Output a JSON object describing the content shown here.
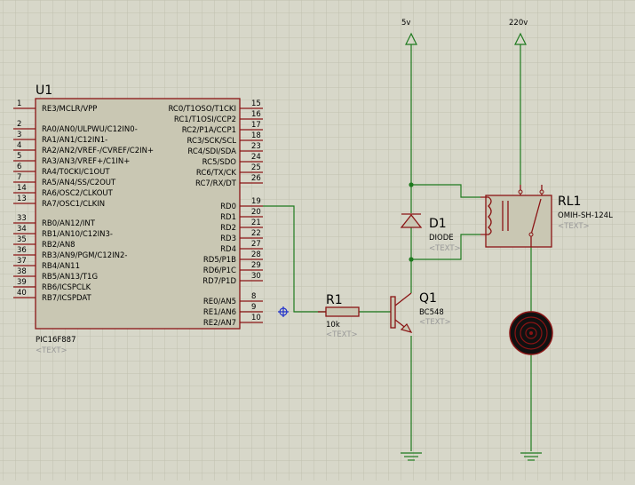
{
  "schematic": {
    "mcu": {
      "ref": "U1",
      "part": "PIC16F887",
      "text_placeholder": "<TEXT>",
      "left_pins": [
        {
          "num": "1",
          "name": "RE3/MCLR/VPP"
        },
        {
          "num": "2",
          "name": "RA0/AN0/ULPWU/C12IN0-"
        },
        {
          "num": "3",
          "name": "RA1/AN1/C12IN1-"
        },
        {
          "num": "4",
          "name": "RA2/AN2/VREF-/CVREF/C2IN+"
        },
        {
          "num": "5",
          "name": "RA3/AN3/VREF+/C1IN+"
        },
        {
          "num": "6",
          "name": "RA4/T0CKI/C1OUT"
        },
        {
          "num": "7",
          "name": "RA5/AN4/SS/C2OUT"
        },
        {
          "num": "14",
          "name": "RA6/OSC2/CLKOUT"
        },
        {
          "num": "13",
          "name": "RA7/OSC1/CLKIN"
        },
        {
          "num": "33",
          "name": "RB0/AN12/INT"
        },
        {
          "num": "34",
          "name": "RB1/AN10/C12IN3-"
        },
        {
          "num": "35",
          "name": "RB2/AN8"
        },
        {
          "num": "36",
          "name": "RB3/AN9/PGM/C12IN2-"
        },
        {
          "num": "37",
          "name": "RB4/AN11"
        },
        {
          "num": "38",
          "name": "RB5/AN13/T1G"
        },
        {
          "num": "39",
          "name": "RB6/ICSPCLK"
        },
        {
          "num": "40",
          "name": "RB7/ICSPDAT"
        }
      ],
      "right_pins": [
        {
          "num": "15",
          "name": "RC0/T1OSO/T1CKI"
        },
        {
          "num": "16",
          "name": "RC1/T1OSI/CCP2"
        },
        {
          "num": "17",
          "name": "RC2/P1A/CCP1"
        },
        {
          "num": "18",
          "name": "RC3/SCK/SCL"
        },
        {
          "num": "23",
          "name": "RC4/SDI/SDA"
        },
        {
          "num": "24",
          "name": "RC5/SDO"
        },
        {
          "num": "25",
          "name": "RC6/TX/CK"
        },
        {
          "num": "26",
          "name": "RC7/RX/DT"
        },
        {
          "num": "19",
          "name": "RD0"
        },
        {
          "num": "20",
          "name": "RD1"
        },
        {
          "num": "21",
          "name": "RD2"
        },
        {
          "num": "22",
          "name": "RD3"
        },
        {
          "num": "27",
          "name": "RD4"
        },
        {
          "num": "28",
          "name": "RD5/P1B"
        },
        {
          "num": "29",
          "name": "RD6/P1C"
        },
        {
          "num": "30",
          "name": "RD7/P1D"
        },
        {
          "num": "8",
          "name": "RE0/AN5"
        },
        {
          "num": "9",
          "name": "RE1/AN6"
        },
        {
          "num": "10",
          "name": "RE2/AN7"
        }
      ]
    },
    "r1": {
      "ref": "R1",
      "value": "10k",
      "text_placeholder": "<TEXT>"
    },
    "q1": {
      "ref": "Q1",
      "value": "BC548",
      "text_placeholder": "<TEXT>"
    },
    "d1": {
      "ref": "D1",
      "value": "DIODE",
      "text_placeholder": "<TEXT>"
    },
    "rl1": {
      "ref": "RL1",
      "value": "OMIH-SH-124L",
      "text_placeholder": "<TEXT>"
    },
    "power_5v": "5v",
    "power_220v": "220v",
    "colors": {
      "background": "#d7d7c9",
      "grid": "#c2c2b3",
      "component_outline": "#8a1414",
      "chip_fill": "#c9c7b3",
      "wire": "#1e7a1e",
      "probe": "#2233cc",
      "placeholder_text": "#999999"
    }
  }
}
